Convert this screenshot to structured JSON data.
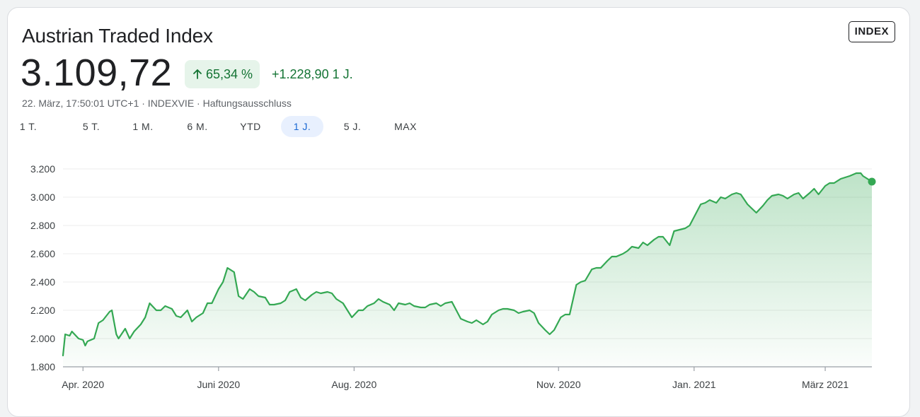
{
  "header": {
    "title": "Austrian Traded Index",
    "badge": "INDEX",
    "price": "3.109,72",
    "change_pct": "65,34 %",
    "change_abs": "+1.228,90 1 J.",
    "meta": "22. März, 17:50:01 UTC+1 · INDEXVIE · Haftungsausschluss"
  },
  "tabs": [
    {
      "label": "1 T.",
      "active": false
    },
    {
      "label": "5 T.",
      "active": false
    },
    {
      "label": "1 M.",
      "active": false
    },
    {
      "label": "6 M.",
      "active": false
    },
    {
      "label": "YTD",
      "active": false
    },
    {
      "label": "1 J.",
      "active": true
    },
    {
      "label": "5 J.",
      "active": false
    },
    {
      "label": "MAX",
      "active": false
    }
  ],
  "colors": {
    "line": "#34a853",
    "positive_text": "#137333",
    "pill_bg": "#e6f4ea",
    "active_tab_bg": "#e8f0fe",
    "active_tab_text": "#1967d2"
  },
  "icons": {
    "change_arrow": "arrow-up-icon"
  },
  "chart_data": {
    "type": "area",
    "title": "",
    "xlabel": "",
    "ylabel": "",
    "ylim": [
      1800,
      3200
    ],
    "y_ticks": [
      {
        "value": 1800,
        "label": "1.800"
      },
      {
        "value": 2000,
        "label": "2.000"
      },
      {
        "value": 2200,
        "label": "2.200"
      },
      {
        "value": 2400,
        "label": "2.400"
      },
      {
        "value": 2600,
        "label": "2.600"
      },
      {
        "value": 2800,
        "label": "2.800"
      },
      {
        "value": 3000,
        "label": "3.000"
      },
      {
        "value": 3200,
        "label": "3.200"
      }
    ],
    "x_ticks": [
      {
        "value": "2020-04-01",
        "label": "Apr. 2020"
      },
      {
        "value": "2020-06-01",
        "label": "Juni 2020"
      },
      {
        "value": "2020-08-01",
        "label": "Aug. 2020"
      },
      {
        "value": "2020-11-01",
        "label": "Nov. 2020"
      },
      {
        "value": "2021-01-01",
        "label": "Jan. 2021"
      },
      {
        "value": "2021-03-01",
        "label": "März 2021"
      }
    ],
    "xlim": [
      "2020-03-23",
      "2021-03-22"
    ],
    "grid": true,
    "series": [
      {
        "points": [
          [
            "2020-03-23",
            1880
          ],
          [
            "2020-03-24",
            2030
          ],
          [
            "2020-03-26",
            2020
          ],
          [
            "2020-03-27",
            2050
          ],
          [
            "2020-03-30",
            2000
          ],
          [
            "2020-04-01",
            1990
          ],
          [
            "2020-04-02",
            1950
          ],
          [
            "2020-04-03",
            1980
          ],
          [
            "2020-04-06",
            2000
          ],
          [
            "2020-04-08",
            2110
          ],
          [
            "2020-04-10",
            2130
          ],
          [
            "2020-04-13",
            2190
          ],
          [
            "2020-04-14",
            2200
          ],
          [
            "2020-04-16",
            2030
          ],
          [
            "2020-04-17",
            2000
          ],
          [
            "2020-04-20",
            2070
          ],
          [
            "2020-04-22",
            2000
          ],
          [
            "2020-04-24",
            2050
          ],
          [
            "2020-04-27",
            2100
          ],
          [
            "2020-04-29",
            2150
          ],
          [
            "2020-05-01",
            2250
          ],
          [
            "2020-05-04",
            2200
          ],
          [
            "2020-05-06",
            2200
          ],
          [
            "2020-05-08",
            2230
          ],
          [
            "2020-05-11",
            2210
          ],
          [
            "2020-05-13",
            2160
          ],
          [
            "2020-05-15",
            2150
          ],
          [
            "2020-05-18",
            2200
          ],
          [
            "2020-05-20",
            2120
          ],
          [
            "2020-05-22",
            2150
          ],
          [
            "2020-05-25",
            2180
          ],
          [
            "2020-05-27",
            2250
          ],
          [
            "2020-05-29",
            2250
          ],
          [
            "2020-06-01",
            2350
          ],
          [
            "2020-06-03",
            2400
          ],
          [
            "2020-06-05",
            2500
          ],
          [
            "2020-06-08",
            2470
          ],
          [
            "2020-06-10",
            2300
          ],
          [
            "2020-06-12",
            2280
          ],
          [
            "2020-06-15",
            2350
          ],
          [
            "2020-06-17",
            2330
          ],
          [
            "2020-06-19",
            2300
          ],
          [
            "2020-06-22",
            2290
          ],
          [
            "2020-06-24",
            2240
          ],
          [
            "2020-06-26",
            2240
          ],
          [
            "2020-06-29",
            2250
          ],
          [
            "2020-07-01",
            2270
          ],
          [
            "2020-07-03",
            2330
          ],
          [
            "2020-07-06",
            2350
          ],
          [
            "2020-07-08",
            2290
          ],
          [
            "2020-07-10",
            2270
          ],
          [
            "2020-07-13",
            2310
          ],
          [
            "2020-07-15",
            2330
          ],
          [
            "2020-07-17",
            2320
          ],
          [
            "2020-07-20",
            2330
          ],
          [
            "2020-07-22",
            2320
          ],
          [
            "2020-07-24",
            2280
          ],
          [
            "2020-07-27",
            2250
          ],
          [
            "2020-07-29",
            2200
          ],
          [
            "2020-07-31",
            2150
          ],
          [
            "2020-08-03",
            2200
          ],
          [
            "2020-08-05",
            2200
          ],
          [
            "2020-08-07",
            2230
          ],
          [
            "2020-08-10",
            2250
          ],
          [
            "2020-08-12",
            2280
          ],
          [
            "2020-08-14",
            2260
          ],
          [
            "2020-08-17",
            2240
          ],
          [
            "2020-08-19",
            2200
          ],
          [
            "2020-08-21",
            2250
          ],
          [
            "2020-08-24",
            2240
          ],
          [
            "2020-08-26",
            2250
          ],
          [
            "2020-08-28",
            2230
          ],
          [
            "2020-08-31",
            2220
          ],
          [
            "2020-09-02",
            2220
          ],
          [
            "2020-09-04",
            2240
          ],
          [
            "2020-09-07",
            2250
          ],
          [
            "2020-09-09",
            2230
          ],
          [
            "2020-09-11",
            2250
          ],
          [
            "2020-09-14",
            2260
          ],
          [
            "2020-09-16",
            2200
          ],
          [
            "2020-09-18",
            2140
          ],
          [
            "2020-09-21",
            2120
          ],
          [
            "2020-09-23",
            2110
          ],
          [
            "2020-09-25",
            2130
          ],
          [
            "2020-09-28",
            2100
          ],
          [
            "2020-09-30",
            2120
          ],
          [
            "2020-10-02",
            2170
          ],
          [
            "2020-10-05",
            2200
          ],
          [
            "2020-10-07",
            2210
          ],
          [
            "2020-10-09",
            2210
          ],
          [
            "2020-10-12",
            2200
          ],
          [
            "2020-10-14",
            2180
          ],
          [
            "2020-10-16",
            2190
          ],
          [
            "2020-10-19",
            2200
          ],
          [
            "2020-10-21",
            2180
          ],
          [
            "2020-10-23",
            2110
          ],
          [
            "2020-10-26",
            2060
          ],
          [
            "2020-10-28",
            2030
          ],
          [
            "2020-10-30",
            2060
          ],
          [
            "2020-11-02",
            2150
          ],
          [
            "2020-11-04",
            2170
          ],
          [
            "2020-11-06",
            2170
          ],
          [
            "2020-11-09",
            2380
          ],
          [
            "2020-11-11",
            2400
          ],
          [
            "2020-11-13",
            2410
          ],
          [
            "2020-11-16",
            2490
          ],
          [
            "2020-11-18",
            2500
          ],
          [
            "2020-11-20",
            2500
          ],
          [
            "2020-11-23",
            2550
          ],
          [
            "2020-11-25",
            2580
          ],
          [
            "2020-11-27",
            2580
          ],
          [
            "2020-11-30",
            2600
          ],
          [
            "2020-12-02",
            2620
          ],
          [
            "2020-12-04",
            2650
          ],
          [
            "2020-12-07",
            2640
          ],
          [
            "2020-12-09",
            2680
          ],
          [
            "2020-12-11",
            2660
          ],
          [
            "2020-12-14",
            2700
          ],
          [
            "2020-12-16",
            2720
          ],
          [
            "2020-12-18",
            2720
          ],
          [
            "2020-12-21",
            2660
          ],
          [
            "2020-12-23",
            2760
          ],
          [
            "2020-12-28",
            2780
          ],
          [
            "2020-12-30",
            2800
          ],
          [
            "2021-01-04",
            2950
          ],
          [
            "2021-01-06",
            2960
          ],
          [
            "2021-01-08",
            2980
          ],
          [
            "2021-01-11",
            2960
          ],
          [
            "2021-01-13",
            3000
          ],
          [
            "2021-01-15",
            2990
          ],
          [
            "2021-01-18",
            3020
          ],
          [
            "2021-01-20",
            3030
          ],
          [
            "2021-01-22",
            3020
          ],
          [
            "2021-01-25",
            2950
          ],
          [
            "2021-01-27",
            2920
          ],
          [
            "2021-01-29",
            2890
          ],
          [
            "2021-02-01",
            2940
          ],
          [
            "2021-02-03",
            2980
          ],
          [
            "2021-02-05",
            3010
          ],
          [
            "2021-02-08",
            3020
          ],
          [
            "2021-02-10",
            3010
          ],
          [
            "2021-02-12",
            2990
          ],
          [
            "2021-02-15",
            3020
          ],
          [
            "2021-02-17",
            3030
          ],
          [
            "2021-02-19",
            2990
          ],
          [
            "2021-02-22",
            3030
          ],
          [
            "2021-02-24",
            3060
          ],
          [
            "2021-02-26",
            3020
          ],
          [
            "2021-03-01",
            3080
          ],
          [
            "2021-03-03",
            3100
          ],
          [
            "2021-03-05",
            3100
          ],
          [
            "2021-03-08",
            3130
          ],
          [
            "2021-03-10",
            3140
          ],
          [
            "2021-03-12",
            3150
          ],
          [
            "2021-03-15",
            3170
          ],
          [
            "2021-03-17",
            3170
          ],
          [
            "2021-03-18",
            3150
          ],
          [
            "2021-03-19",
            3140
          ],
          [
            "2021-03-22",
            3110
          ]
        ]
      }
    ]
  }
}
